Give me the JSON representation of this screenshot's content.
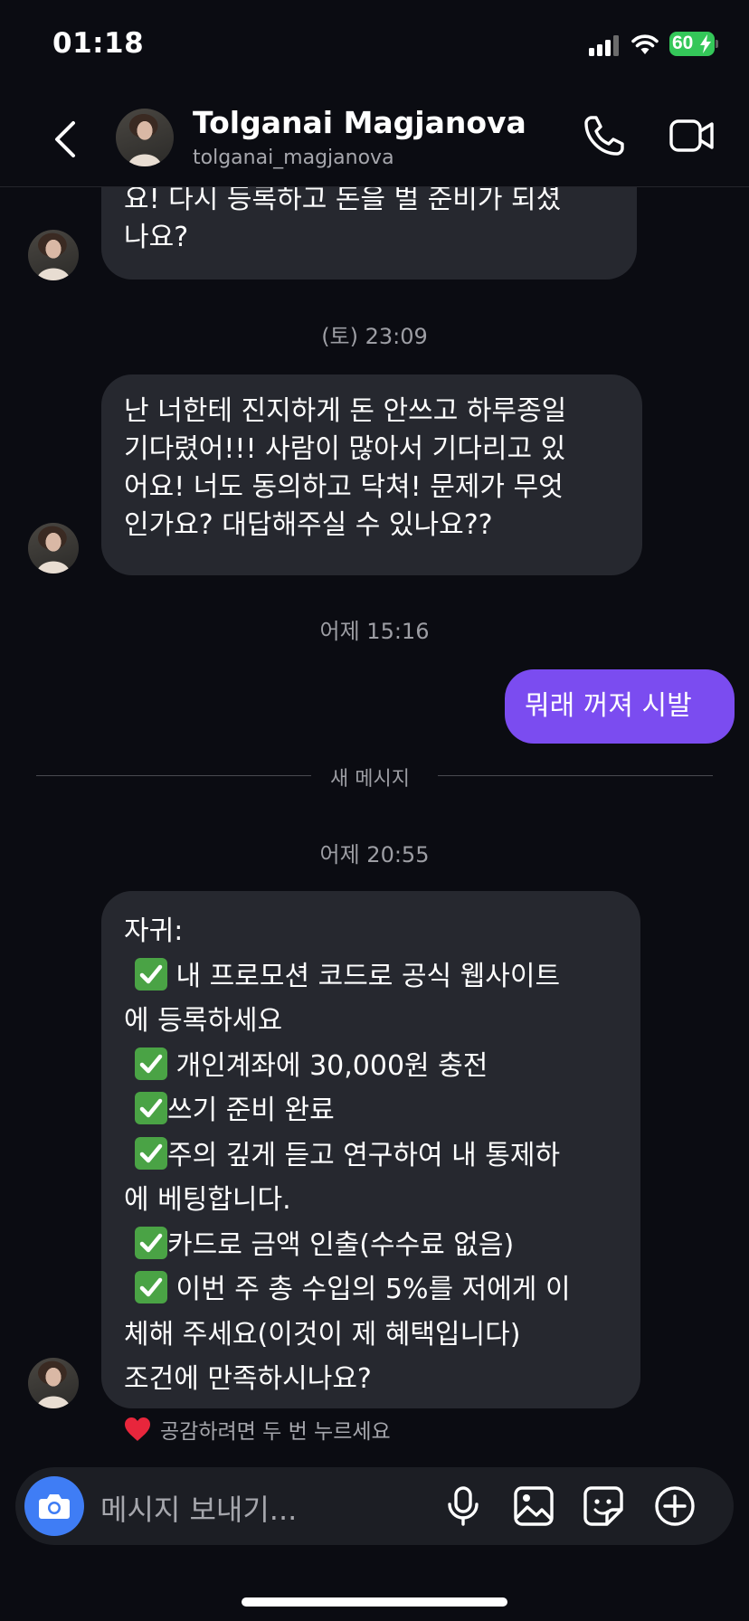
{
  "status_bar": {
    "time": "01:18",
    "battery": "60"
  },
  "header": {
    "name": "Tolganai Magjanova",
    "username": "tolganai_magjanova"
  },
  "messages": {
    "m1": {
      "lines": [
        "요!  다시 등록하고 돈을 벌 준비가 되셨",
        "나요?"
      ]
    },
    "ts1": "(토) 23:09",
    "m2": {
      "lines": [
        "난 너한테 진지하게 돈 안쓰고 하루종일",
        "기다렸어!!!  사람이 많아서 기다리고 있",
        "어요!  너도 동의하고 닥쳐!  문제가 무엇",
        "인가요? 대답해주실 수 있나요??"
      ]
    },
    "ts2": "어제 15:16",
    "sent1": "뭐래 꺼져 시발",
    "new_divider": "새 메시지",
    "ts3": "어제 20:55",
    "m3": {
      "l1": "자귀:",
      "l2": " 내 프로모션 코드로 공식 웹사이트",
      "l3": "에 등록하세요",
      "l4": " 개인계좌에 30,000원 충전",
      "l5": "쓰기 준비 완료",
      "l6": "주의 깊게 듣고 연구하여 내 통제하",
      "l7": "에 베팅합니다.",
      "l8": "카드로 금액 인출(수수료 없음)",
      "l9": " 이번 주 총 수입의 5%를 저에게 이",
      "l10": "체해 주세요(이것이 제 혜택입니다)",
      "l11": " 조건에 만족하시나요?"
    },
    "reaction_hint": "공감하려면 두 번 누르세요"
  },
  "composer": {
    "placeholder": "메시지 보내기..."
  },
  "icons": {
    "back": "chevron-left-icon",
    "call": "phone-icon",
    "video": "video-camera-icon",
    "camera": "camera-icon",
    "mic": "microphone-icon",
    "gallery": "image-icon",
    "sticker": "sticker-icon",
    "add": "plus-circle-icon",
    "check": "check-mark-emoji",
    "heart": "heart-emoji"
  },
  "colors": {
    "sent_bubble": "#7b4cf0",
    "received_bubble": "#26282f",
    "camera_button": "#3f7df5",
    "battery": "#34c759"
  }
}
